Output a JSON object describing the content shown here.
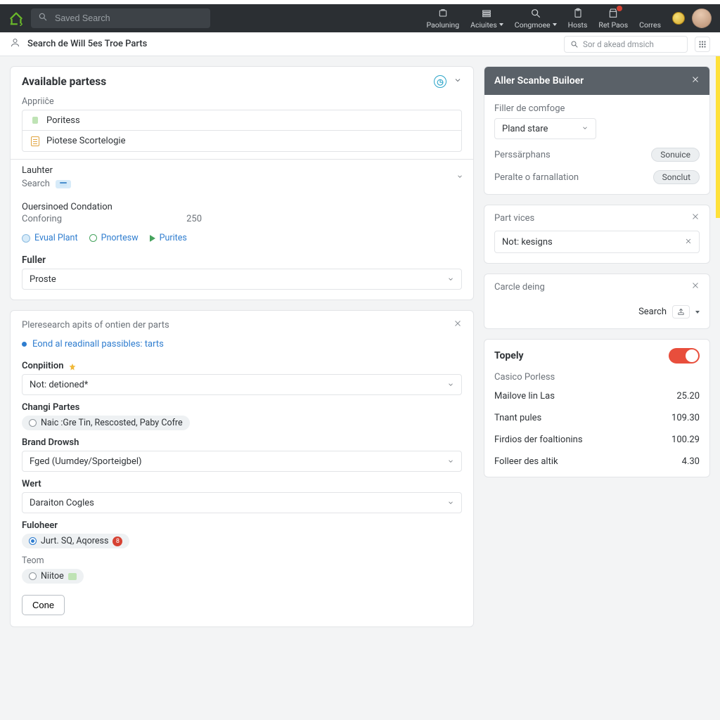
{
  "top": {
    "search_placeholder": "Saved Search",
    "nav": [
      {
        "label": "Paoluning",
        "caret": false
      },
      {
        "label": "Aciuites",
        "caret": true
      },
      {
        "label": "Congmoee",
        "caret": true
      },
      {
        "label": "Hosts",
        "caret": false
      },
      {
        "label": "Ret Paos",
        "caret": false
      },
      {
        "label": "Corres",
        "caret": false
      }
    ]
  },
  "subbar": {
    "title": "Search de Will 5es Troe Parts",
    "search_placeholder": "Sor d akead dmsich"
  },
  "available": {
    "heading": "Available partess",
    "apprice_label": "Appriiĉe",
    "apprice_options": [
      "Poritess",
      "Piotese Scortelogie"
    ],
    "lauhter_label": "Lauhter",
    "lauhter_search_label": "Search",
    "oversinoed_label": "Ouersinoed Condation",
    "contoring_label": "Conforing",
    "contoring_value": "250",
    "chips": [
      "Evual Plant",
      "Pnortesw",
      "Purites"
    ],
    "fuller_label": "Fuller",
    "fuller_value": "Proste"
  },
  "research": {
    "heading": "Pleresearch apits of ontien der parts",
    "bullet_text": "Eond al readinall passibles: tarts",
    "condition_label": "Conpiition",
    "condition_value": "Not: detioned*",
    "chang_label": "Changi Partes",
    "chang_chip": "Naic :Gre  Tin,  Rescosted,  Paby Cofre",
    "brand_label": "Brand Drowsh",
    "brand_value": "Fged (Uumdey/Sporteigbel)",
    "wert_label": "Wert",
    "wert_value": "Daraiton Cogles",
    "fulohner_label": "Fuloheer",
    "fulohner_chip": "Jurt. SQ,  Aqoress",
    "teom_label": "Teom",
    "teom_chip": "Niitoe",
    "done_label": "Cone"
  },
  "builder": {
    "heading": "Aller Scanbe Builoer",
    "filter_label": "Filler de comfoge",
    "filter_value": "Pland stare",
    "rows": [
      {
        "label": "Perssärphans",
        "btn": "Sonuice"
      },
      {
        "label": "Peralte o farnallation",
        "btn": "Sonclut"
      }
    ]
  },
  "part_vices": {
    "heading": "Part vices",
    "token": "Not: kesigns"
  },
  "carcle": {
    "heading": "Carcle deing",
    "search_label": "Search"
  },
  "topely": {
    "heading": "Topely",
    "sub": "Casico Porless",
    "rows": [
      {
        "label": "Mailove lin Las",
        "value": "25.20"
      },
      {
        "label": "Tnant pules",
        "value": "109.30"
      },
      {
        "label": "Firdios der foaltionins",
        "value": "100.29"
      },
      {
        "label": "Folleer des altik",
        "value": "4.30"
      }
    ]
  }
}
